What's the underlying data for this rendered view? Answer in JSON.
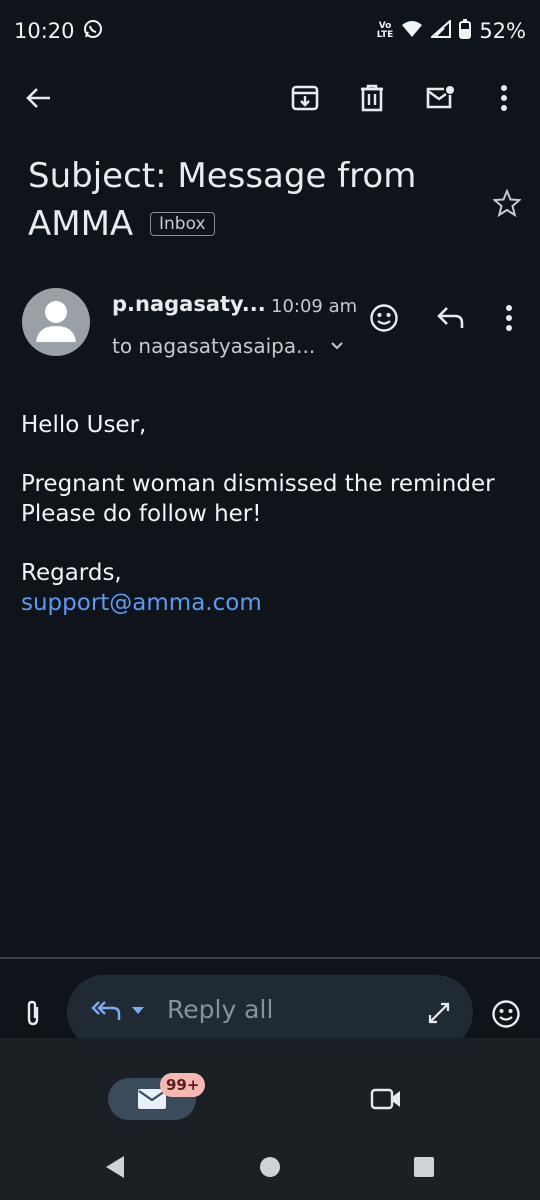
{
  "status_bar": {
    "time": "10:20",
    "volte_top": "Vo",
    "volte_bottom": "LTE",
    "battery": "52%"
  },
  "email": {
    "subject": "Subject: Message from AMMA",
    "label": "Inbox",
    "sender": "p.nagasaty...",
    "time": "10:09 am",
    "to": "to nagasatyasaipa...",
    "body": {
      "greeting": "Hello User,",
      "line1": "Pregnant woman dismissed the reminder",
      "line2": "Please do follow her!",
      "closing": "Regards,",
      "signature_link": "support@amma.com"
    }
  },
  "compose": {
    "reply_label": "Reply all"
  },
  "bottom_nav": {
    "mail_badge": "99+"
  },
  "colors": {
    "background": "#0f141a",
    "link": "#5b9bf1",
    "accent_blue": "#7cacf8",
    "badge": "#f7b8b1"
  }
}
